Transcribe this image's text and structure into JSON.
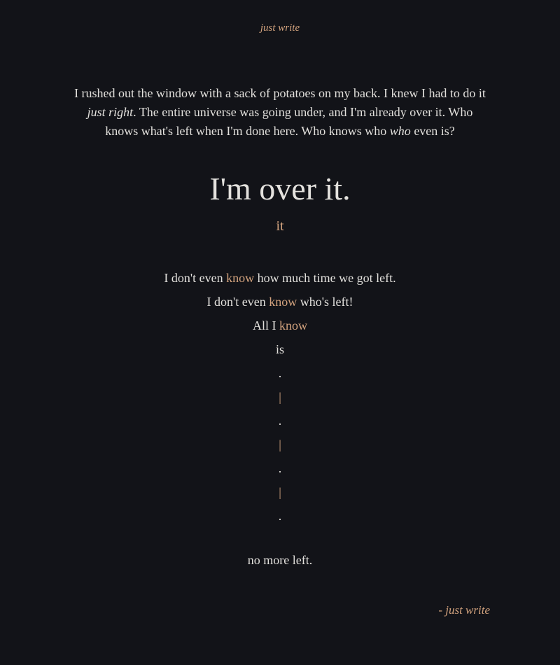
{
  "header": {
    "title": "just write"
  },
  "intro": {
    "part1": "I rushed out the window with a sack of potatoes on my back. I knew I had to do it ",
    "emphasis1": "just right",
    "part2": ". The entire universe was going under, and I'm already over it. Who knows what's left when I'm done here. Who knows who ",
    "emphasis2": "who",
    "part3": " even is?"
  },
  "title": "I'm over it.",
  "subtitle": "it",
  "stanza": {
    "line1_pre": "I don't even ",
    "line1_accent": "know",
    "line1_post": " how much time we got left.",
    "line2_pre": "I don't even ",
    "line2_accent": "know",
    "line2_post": " who's left!",
    "line3_pre": "All I ",
    "line3_accent": "know",
    "line4": "is",
    "dot": ".",
    "bar": "|"
  },
  "ending": "no more left.",
  "signature": "- just write",
  "colors": {
    "background": "#121318",
    "text": "#e2e0dc",
    "accent": "#d3a37e"
  }
}
